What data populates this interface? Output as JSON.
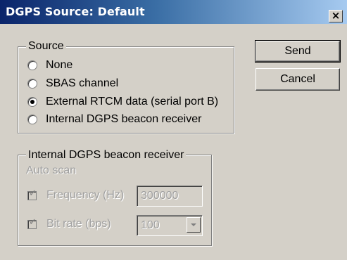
{
  "window": {
    "title": "DGPS Source: Default",
    "close_glyph": "×"
  },
  "source_group": {
    "legend": "Source",
    "options": [
      {
        "label": "None",
        "checked": false
      },
      {
        "label": "SBAS channel",
        "checked": false
      },
      {
        "label": "External RTCM data (serial port B)",
        "checked": true
      },
      {
        "label": "Internal DGPS beacon receiver",
        "checked": false
      }
    ]
  },
  "buttons": {
    "send": "Send",
    "cancel": "Cancel"
  },
  "beacon_group": {
    "legend": "Internal DGPS beacon receiver",
    "auto_scan_label": "Auto scan",
    "frequency": {
      "label": "Frequency (Hz)",
      "checked": true,
      "value": "300000"
    },
    "bit_rate": {
      "label": "Bit rate (bps)",
      "checked": true,
      "value": "100"
    }
  }
}
